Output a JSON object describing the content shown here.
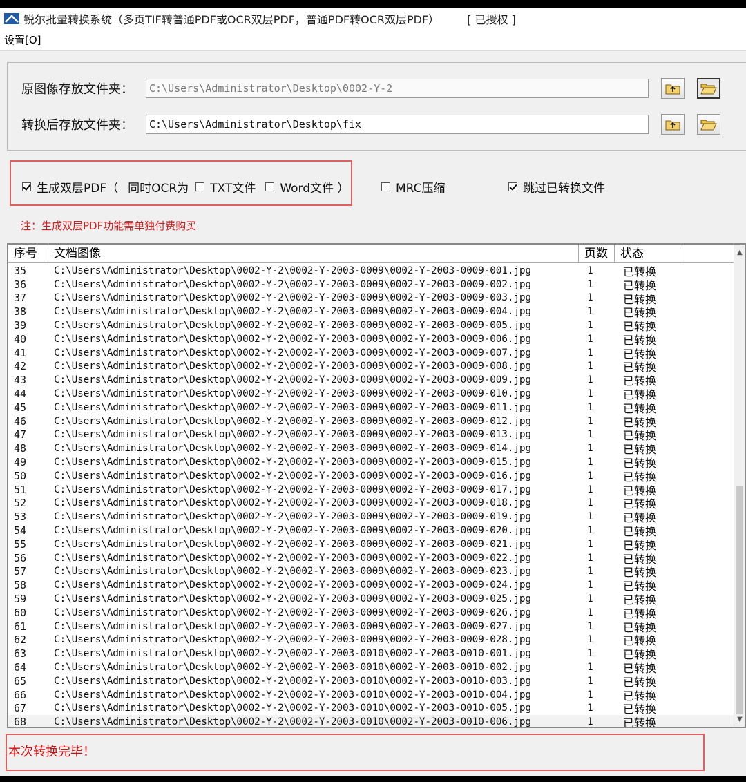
{
  "window": {
    "title": "锐尔批量转换系统（多页TIF转普通PDF或OCR双层PDF，普通PDF转OCR双层PDF）",
    "license_status": "[ 已授权 ]"
  },
  "menu": {
    "settings": "设置[O]"
  },
  "folders": {
    "source_label": "原图像存放文件夹：",
    "source_path": "C:\\Users\\Administrator\\Desktop\\0002-Y-2",
    "output_label": "转换后存放文件夹：",
    "output_path": "C:\\Users\\Administrator\\Desktop\\fix"
  },
  "options": {
    "dual_layer_pdf": "生成双层PDF（",
    "dual_layer_checked": true,
    "ocr_also": "同时OCR为",
    "txt_file": "TXT文件",
    "txt_checked": false,
    "word_file": "Word文件 ）",
    "word_checked": false,
    "mrc": "MRC压缩",
    "mrc_checked": false,
    "skip_converted": "跳过已转换文件",
    "skip_checked": true,
    "note": "注：生成双层PDF功能需单独付费购买"
  },
  "table": {
    "columns": [
      "序号",
      "文档图像",
      "页数",
      "状态"
    ],
    "rows": [
      {
        "no": "35",
        "path": "C:\\Users\\Administrator\\Desktop\\0002-Y-2\\0002-Y-2003-0009\\0002-Y-2003-0009-001.jpg",
        "pages": "1",
        "status": "已转换"
      },
      {
        "no": "36",
        "path": "C:\\Users\\Administrator\\Desktop\\0002-Y-2\\0002-Y-2003-0009\\0002-Y-2003-0009-002.jpg",
        "pages": "1",
        "status": "已转换"
      },
      {
        "no": "37",
        "path": "C:\\Users\\Administrator\\Desktop\\0002-Y-2\\0002-Y-2003-0009\\0002-Y-2003-0009-003.jpg",
        "pages": "1",
        "status": "已转换"
      },
      {
        "no": "38",
        "path": "C:\\Users\\Administrator\\Desktop\\0002-Y-2\\0002-Y-2003-0009\\0002-Y-2003-0009-004.jpg",
        "pages": "1",
        "status": "已转换"
      },
      {
        "no": "39",
        "path": "C:\\Users\\Administrator\\Desktop\\0002-Y-2\\0002-Y-2003-0009\\0002-Y-2003-0009-005.jpg",
        "pages": "1",
        "status": "已转换"
      },
      {
        "no": "40",
        "path": "C:\\Users\\Administrator\\Desktop\\0002-Y-2\\0002-Y-2003-0009\\0002-Y-2003-0009-006.jpg",
        "pages": "1",
        "status": "已转换"
      },
      {
        "no": "41",
        "path": "C:\\Users\\Administrator\\Desktop\\0002-Y-2\\0002-Y-2003-0009\\0002-Y-2003-0009-007.jpg",
        "pages": "1",
        "status": "已转换"
      },
      {
        "no": "42",
        "path": "C:\\Users\\Administrator\\Desktop\\0002-Y-2\\0002-Y-2003-0009\\0002-Y-2003-0009-008.jpg",
        "pages": "1",
        "status": "已转换"
      },
      {
        "no": "43",
        "path": "C:\\Users\\Administrator\\Desktop\\0002-Y-2\\0002-Y-2003-0009\\0002-Y-2003-0009-009.jpg",
        "pages": "1",
        "status": "已转换"
      },
      {
        "no": "44",
        "path": "C:\\Users\\Administrator\\Desktop\\0002-Y-2\\0002-Y-2003-0009\\0002-Y-2003-0009-010.jpg",
        "pages": "1",
        "status": "已转换"
      },
      {
        "no": "45",
        "path": "C:\\Users\\Administrator\\Desktop\\0002-Y-2\\0002-Y-2003-0009\\0002-Y-2003-0009-011.jpg",
        "pages": "1",
        "status": "已转换"
      },
      {
        "no": "46",
        "path": "C:\\Users\\Administrator\\Desktop\\0002-Y-2\\0002-Y-2003-0009\\0002-Y-2003-0009-012.jpg",
        "pages": "1",
        "status": "已转换"
      },
      {
        "no": "47",
        "path": "C:\\Users\\Administrator\\Desktop\\0002-Y-2\\0002-Y-2003-0009\\0002-Y-2003-0009-013.jpg",
        "pages": "1",
        "status": "已转换"
      },
      {
        "no": "48",
        "path": "C:\\Users\\Administrator\\Desktop\\0002-Y-2\\0002-Y-2003-0009\\0002-Y-2003-0009-014.jpg",
        "pages": "1",
        "status": "已转换"
      },
      {
        "no": "49",
        "path": "C:\\Users\\Administrator\\Desktop\\0002-Y-2\\0002-Y-2003-0009\\0002-Y-2003-0009-015.jpg",
        "pages": "1",
        "status": "已转换"
      },
      {
        "no": "50",
        "path": "C:\\Users\\Administrator\\Desktop\\0002-Y-2\\0002-Y-2003-0009\\0002-Y-2003-0009-016.jpg",
        "pages": "1",
        "status": "已转换"
      },
      {
        "no": "51",
        "path": "C:\\Users\\Administrator\\Desktop\\0002-Y-2\\0002-Y-2003-0009\\0002-Y-2003-0009-017.jpg",
        "pages": "1",
        "status": "已转换"
      },
      {
        "no": "52",
        "path": "C:\\Users\\Administrator\\Desktop\\0002-Y-2\\0002-Y-2003-0009\\0002-Y-2003-0009-018.jpg",
        "pages": "1",
        "status": "已转换"
      },
      {
        "no": "53",
        "path": "C:\\Users\\Administrator\\Desktop\\0002-Y-2\\0002-Y-2003-0009\\0002-Y-2003-0009-019.jpg",
        "pages": "1",
        "status": "已转换"
      },
      {
        "no": "54",
        "path": "C:\\Users\\Administrator\\Desktop\\0002-Y-2\\0002-Y-2003-0009\\0002-Y-2003-0009-020.jpg",
        "pages": "1",
        "status": "已转换"
      },
      {
        "no": "55",
        "path": "C:\\Users\\Administrator\\Desktop\\0002-Y-2\\0002-Y-2003-0009\\0002-Y-2003-0009-021.jpg",
        "pages": "1",
        "status": "已转换"
      },
      {
        "no": "56",
        "path": "C:\\Users\\Administrator\\Desktop\\0002-Y-2\\0002-Y-2003-0009\\0002-Y-2003-0009-022.jpg",
        "pages": "1",
        "status": "已转换"
      },
      {
        "no": "57",
        "path": "C:\\Users\\Administrator\\Desktop\\0002-Y-2\\0002-Y-2003-0009\\0002-Y-2003-0009-023.jpg",
        "pages": "1",
        "status": "已转换"
      },
      {
        "no": "58",
        "path": "C:\\Users\\Administrator\\Desktop\\0002-Y-2\\0002-Y-2003-0009\\0002-Y-2003-0009-024.jpg",
        "pages": "1",
        "status": "已转换"
      },
      {
        "no": "59",
        "path": "C:\\Users\\Administrator\\Desktop\\0002-Y-2\\0002-Y-2003-0009\\0002-Y-2003-0009-025.jpg",
        "pages": "1",
        "status": "已转换"
      },
      {
        "no": "60",
        "path": "C:\\Users\\Administrator\\Desktop\\0002-Y-2\\0002-Y-2003-0009\\0002-Y-2003-0009-026.jpg",
        "pages": "1",
        "status": "已转换"
      },
      {
        "no": "61",
        "path": "C:\\Users\\Administrator\\Desktop\\0002-Y-2\\0002-Y-2003-0009\\0002-Y-2003-0009-027.jpg",
        "pages": "1",
        "status": "已转换"
      },
      {
        "no": "62",
        "path": "C:\\Users\\Administrator\\Desktop\\0002-Y-2\\0002-Y-2003-0009\\0002-Y-2003-0009-028.jpg",
        "pages": "1",
        "status": "已转换"
      },
      {
        "no": "63",
        "path": "C:\\Users\\Administrator\\Desktop\\0002-Y-2\\0002-Y-2003-0010\\0002-Y-2003-0010-001.jpg",
        "pages": "1",
        "status": "已转换"
      },
      {
        "no": "64",
        "path": "C:\\Users\\Administrator\\Desktop\\0002-Y-2\\0002-Y-2003-0010\\0002-Y-2003-0010-002.jpg",
        "pages": "1",
        "status": "已转换"
      },
      {
        "no": "65",
        "path": "C:\\Users\\Administrator\\Desktop\\0002-Y-2\\0002-Y-2003-0010\\0002-Y-2003-0010-003.jpg",
        "pages": "1",
        "status": "已转换"
      },
      {
        "no": "66",
        "path": "C:\\Users\\Administrator\\Desktop\\0002-Y-2\\0002-Y-2003-0010\\0002-Y-2003-0010-004.jpg",
        "pages": "1",
        "status": "已转换"
      },
      {
        "no": "67",
        "path": "C:\\Users\\Administrator\\Desktop\\0002-Y-2\\0002-Y-2003-0010\\0002-Y-2003-0010-005.jpg",
        "pages": "1",
        "status": "已转换"
      },
      {
        "no": "68",
        "path": "C:\\Users\\Administrator\\Desktop\\0002-Y-2\\0002-Y-2003-0010\\0002-Y-2003-0010-006.jpg",
        "pages": "1",
        "status": "已转换"
      }
    ]
  },
  "status_bar": {
    "message": "本次转换完毕！"
  },
  "colors": {
    "accent_red": "#d01010",
    "highlight_box": "#e06060",
    "title_icon": "#1e5aa8"
  }
}
